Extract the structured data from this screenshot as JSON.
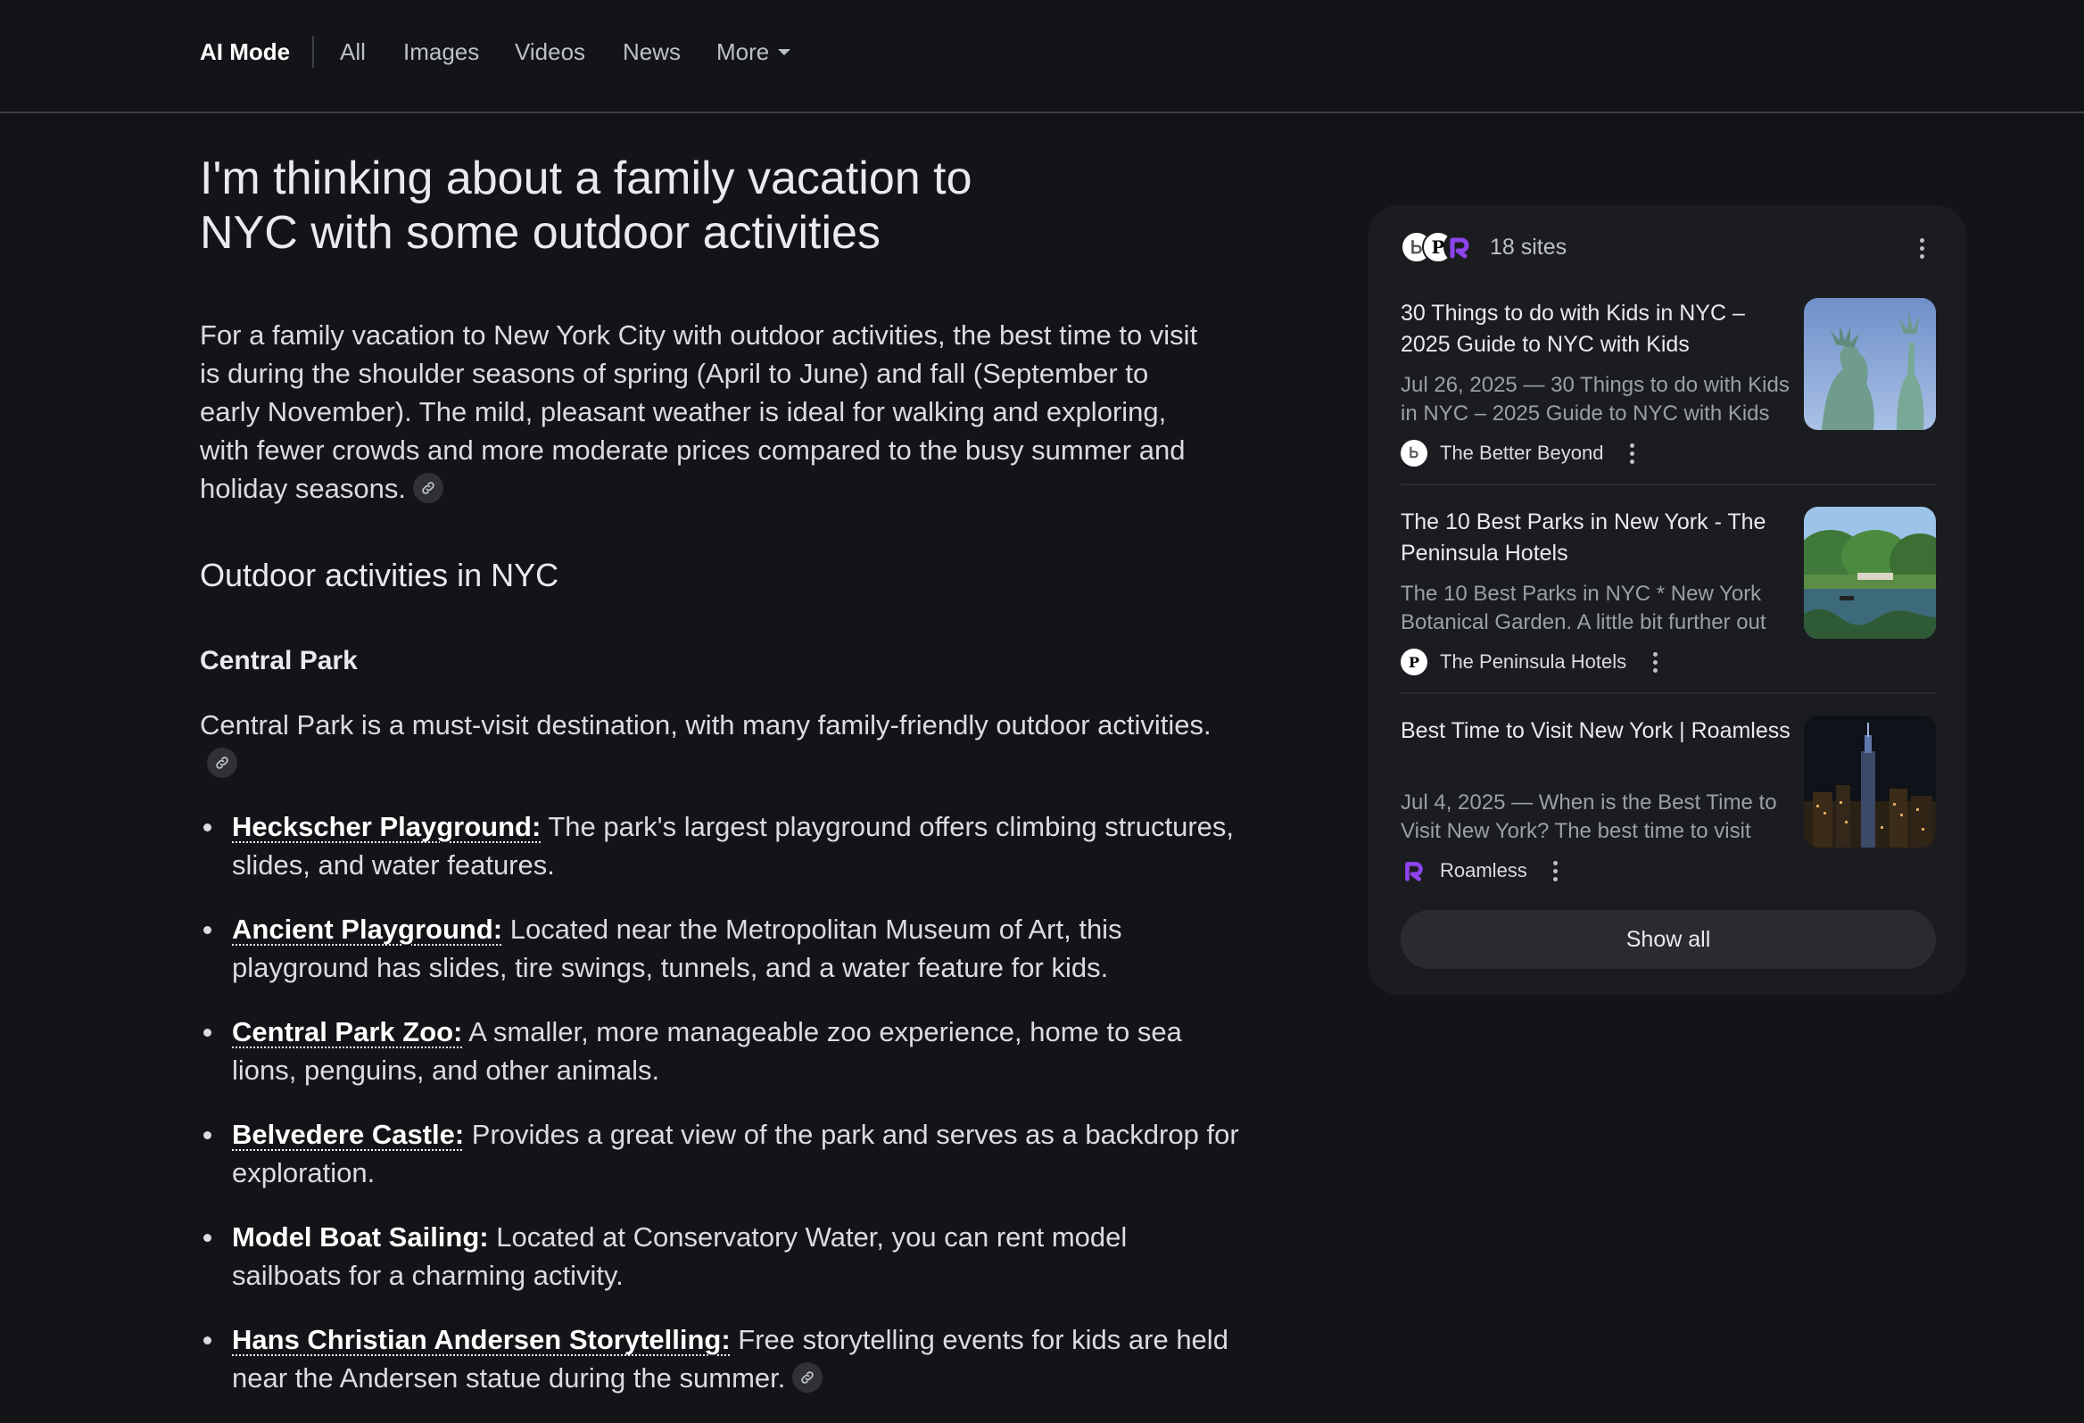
{
  "nav": {
    "items": [
      {
        "label": "AI Mode",
        "active": true
      },
      {
        "label": "All"
      },
      {
        "label": "Images"
      },
      {
        "label": "Videos"
      },
      {
        "label": "News"
      },
      {
        "label": "More"
      }
    ]
  },
  "answer": {
    "query": "I'm thinking about a family vacation to NYC with some outdoor activities",
    "intro": "For a family vacation to New York City with outdoor activities, the best time to visit is during the shoulder seasons of spring (April to June) and fall (September to early November). The mild, pleasant weather is ideal for walking and exploring, with fewer crowds and more moderate prices compared to the busy summer and holiday seasons.",
    "section_title": "Outdoor activities in NYC",
    "subsection_title": "Central Park",
    "subsection_intro": "Central Park is a must-visit destination, with many family-friendly outdoor activities.",
    "bullets": [
      {
        "term": "Heckscher Playground:",
        "text": " The park's largest playground offers climbing structures, slides, and water features."
      },
      {
        "term": "Ancient Playground:",
        "text": " Located near the Metropolitan Museum of Art, this playground has slides, tire swings, tunnels, and a water feature for kids."
      },
      {
        "term": "Central Park Zoo:",
        "text": " A smaller, more manageable zoo experience, home to sea lions, penguins, and other animals."
      },
      {
        "term": "Belvedere Castle:",
        "text": " Provides a great view of the park and serves as a backdrop for exploration."
      },
      {
        "term": "Model Boat Sailing:",
        "text": " Located at Conservatory Water, you can rent model sailboats for a charming activity."
      },
      {
        "term": "Hans Christian Andersen Storytelling:",
        "text": " Free storytelling events for kids are held near the Andersen statue during the summer."
      }
    ]
  },
  "sources": {
    "count_label": "18 sites",
    "show_all_label": "Show all",
    "cards": [
      {
        "title": "30 Things to do with Kids in NYC – 2025 Guide to NYC with Kids",
        "snippet": "Jul 26, 2025 — 30 Things to do with Kids in NYC – 2025 Guide to NYC with Kids",
        "site": "The Better Beyond",
        "favicon_icon": "better-beyond-logo"
      },
      {
        "title": "The 10 Best Parks in New York - The Peninsula Hotels",
        "snippet": "The 10 Best Parks in NYC * New York Botanical Garden. A little bit further out",
        "site": "The Peninsula Hotels",
        "favicon_icon": "peninsula-logo"
      },
      {
        "title": "Best Time to Visit New York | Roamless",
        "snippet": "Jul 4, 2025 — When is the Best Time to Visit New York? The best time to visit",
        "site": "Roamless",
        "favicon_icon": "roamless-logo"
      }
    ]
  },
  "colors": {
    "background": "#131417",
    "panel": "#1b1c20",
    "text": "#e8eaed",
    "muted": "#9aa0a6",
    "roamless_purple": "#8e44ec"
  }
}
